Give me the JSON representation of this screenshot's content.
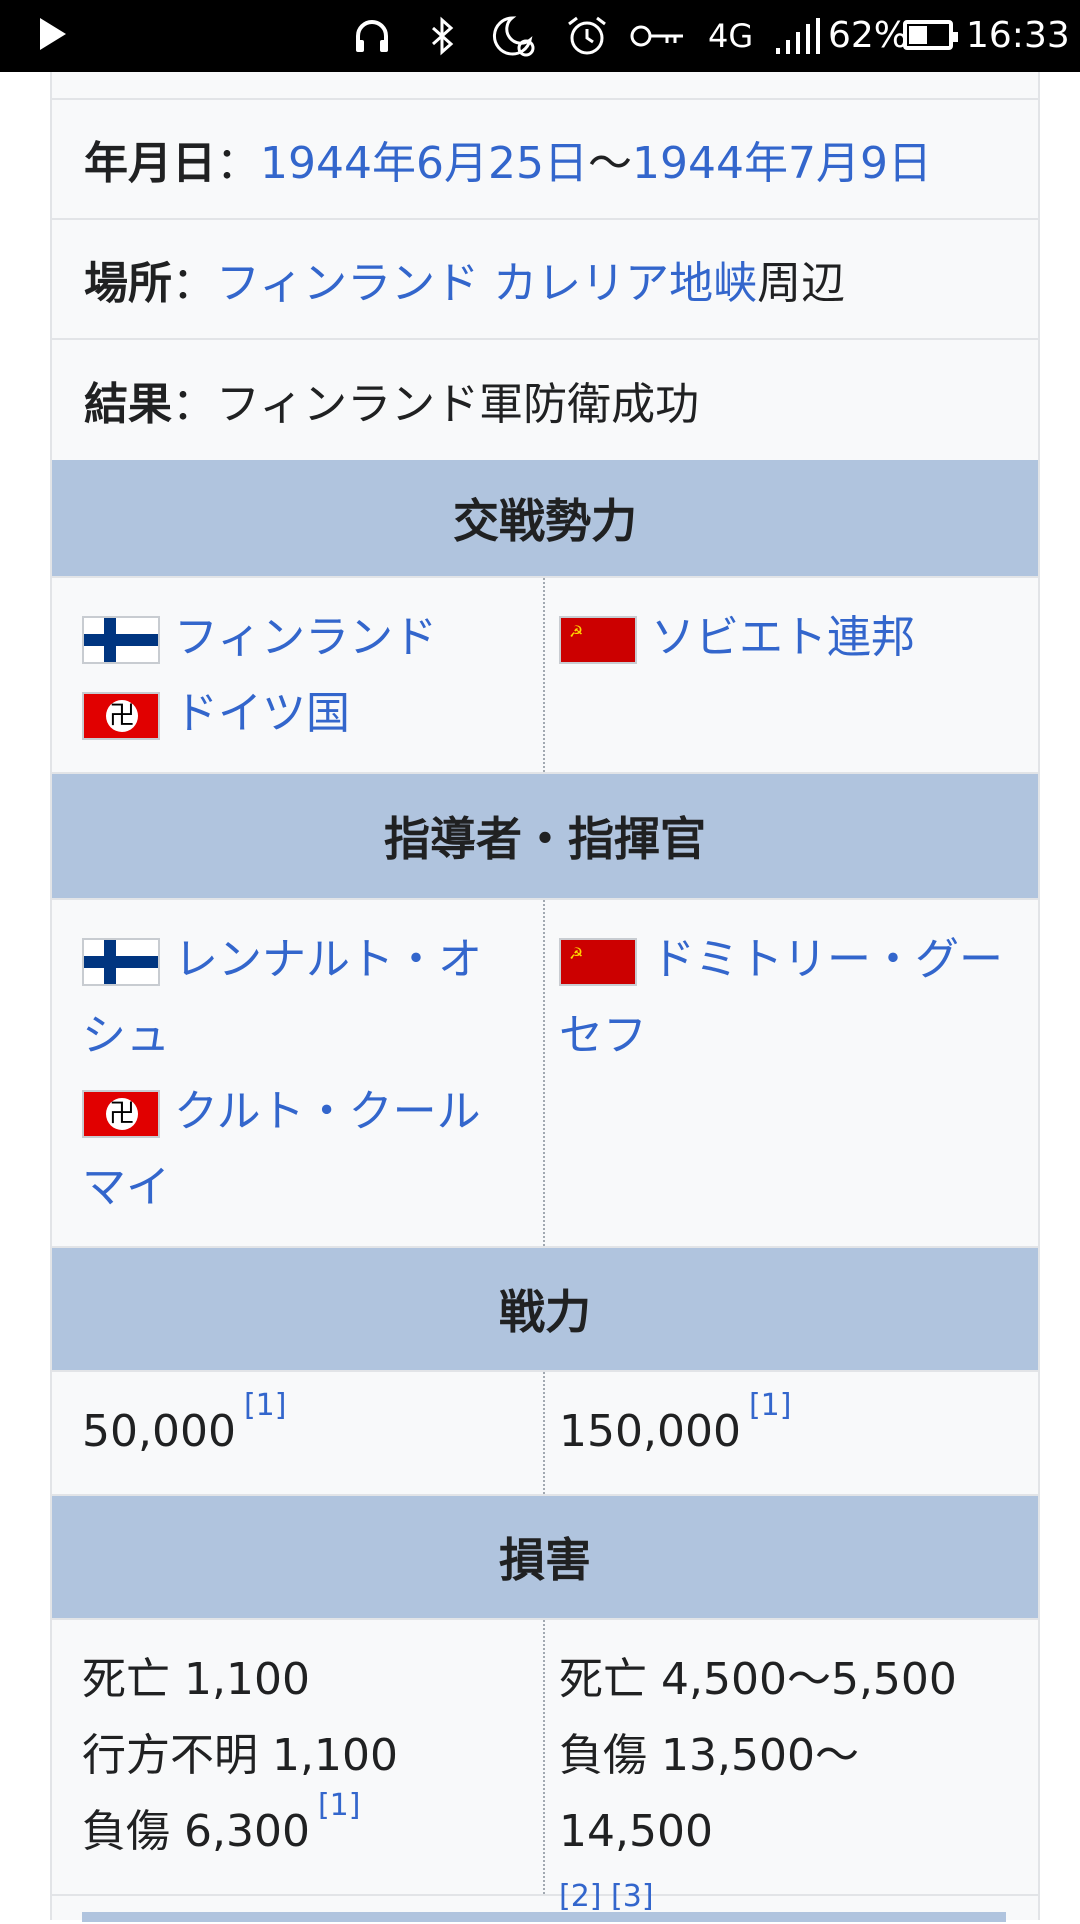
{
  "status_bar": {
    "battery_pct": "62%",
    "time": "16:33",
    "network": "4G",
    "icons": [
      "play-icon",
      "headphones-icon",
      "bluetooth-icon",
      "do-not-disturb-icon",
      "alarm-icon",
      "vpn-key-icon",
      "signal-icon",
      "battery-icon"
    ]
  },
  "info": {
    "date_label": "年月日",
    "date_sep": "：",
    "date_start": "1944年6月25日",
    "date_range_sep": "〜",
    "date_end": "1944年7月9日",
    "place_label": "場所",
    "place_link": "フィンランド カレリア地峡",
    "place_suffix": "周辺",
    "result_label": "結果",
    "result_value": "フィンランド軍防衛成功"
  },
  "sections": {
    "belligerents": "交戦勢力",
    "commanders": "指導者・指揮官",
    "strength": "戦力",
    "casualties": "損害"
  },
  "belligerents": {
    "left": [
      "フィンランド",
      "ドイツ国"
    ],
    "right": [
      "ソビエト連邦"
    ]
  },
  "commanders": {
    "left_1": "レンナルト・オシュ",
    "left_2": "クルト・クールマイ",
    "right_1": "ドミトリー・グーセフ"
  },
  "strength": {
    "left": "50,000",
    "left_ref": "[1]",
    "right": "150,000",
    "right_ref": "[1]"
  },
  "casualties": {
    "left": [
      "死亡 1,100",
      "行方不明 1,100",
      "負傷 6,300"
    ],
    "left_ref": "[1]",
    "right": [
      "死亡 4,500〜5,500",
      "負傷 13,500〜14,500"
    ],
    "right_refs": [
      "[2]",
      "[3]"
    ]
  },
  "colors": {
    "header_bg": "#b0c4de",
    "link": "#3366cc",
    "card_bg": "#f8f9fa"
  }
}
